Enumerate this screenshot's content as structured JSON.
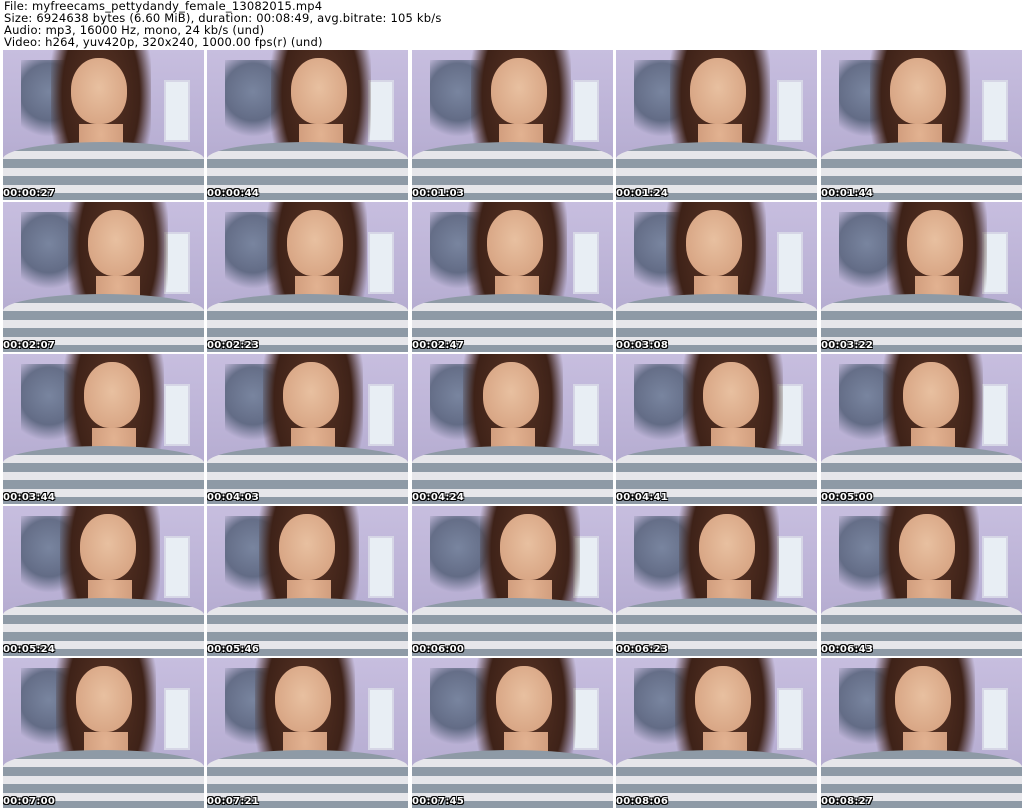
{
  "header": {
    "file": "File: myfreecams_pettydandy_female_13082015.mp4",
    "size": "Size: 6924638 bytes (6.60 MiB), duration: 00:08:49, avg.bitrate: 105 kb/s",
    "audio": "Audio: mp3, 16000 Hz, mono, 24 kb/s (und)",
    "video": "Video: h264, yuv420p, 320x240, 1000.00 fps(r) (und)"
  },
  "thumbnails": [
    {
      "timestamp": "00:00:27"
    },
    {
      "timestamp": "00:00:44"
    },
    {
      "timestamp": "00:01:03"
    },
    {
      "timestamp": "00:01:24"
    },
    {
      "timestamp": "00:01:44"
    },
    {
      "timestamp": "00:02:07"
    },
    {
      "timestamp": "00:02:23"
    },
    {
      "timestamp": "00:02:47"
    },
    {
      "timestamp": "00:03:08"
    },
    {
      "timestamp": "00:03:22"
    },
    {
      "timestamp": "00:03:44"
    },
    {
      "timestamp": "00:04:03"
    },
    {
      "timestamp": "00:04:24"
    },
    {
      "timestamp": "00:04:41"
    },
    {
      "timestamp": "00:05:00"
    },
    {
      "timestamp": "00:05:24"
    },
    {
      "timestamp": "00:05:46"
    },
    {
      "timestamp": "00:06:00"
    },
    {
      "timestamp": "00:06:23"
    },
    {
      "timestamp": "00:06:43"
    },
    {
      "timestamp": "00:07:00"
    },
    {
      "timestamp": "00:07:21"
    },
    {
      "timestamp": "00:07:45"
    },
    {
      "timestamp": "00:08:06"
    },
    {
      "timestamp": "00:08:27"
    }
  ]
}
